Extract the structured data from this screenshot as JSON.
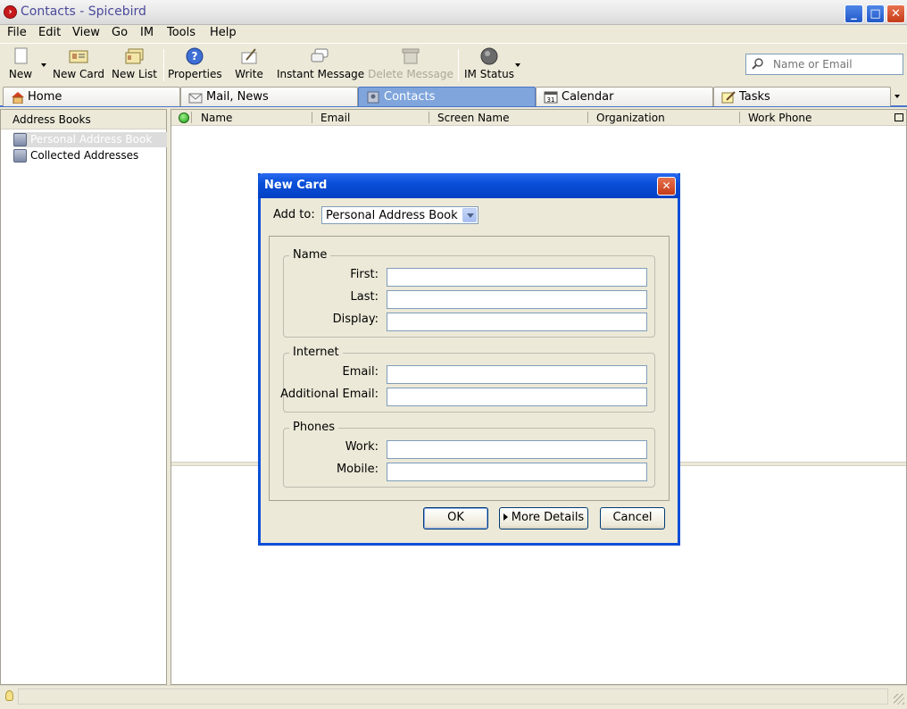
{
  "window": {
    "title": "Contacts - Spicebird"
  },
  "menu": [
    "File",
    "Edit",
    "View",
    "Go",
    "IM",
    "Tools",
    "Help"
  ],
  "toolbar": {
    "new": "New",
    "new_card": "New Card",
    "new_list": "New List",
    "properties": "Properties",
    "write": "Write",
    "instant_message": "Instant Message",
    "delete_message": "Delete Message",
    "im_status": "IM Status"
  },
  "search": {
    "placeholder": "Name or Email"
  },
  "tabs": [
    {
      "label": "Home"
    },
    {
      "label": "Mail, News"
    },
    {
      "label": "Contacts",
      "active": true
    },
    {
      "label": "Calendar"
    },
    {
      "label": "Tasks"
    }
  ],
  "address_books": {
    "header": "Address Books",
    "items": [
      "Personal Address Book",
      "Collected Addresses"
    ]
  },
  "columns": [
    "Name",
    "Email",
    "Screen Name",
    "Organization",
    "Work Phone"
  ],
  "dialog": {
    "title": "New Card",
    "add_to_label": "Add to:",
    "add_to_value": "Personal Address Book",
    "name_group": "Name",
    "first": "First:",
    "last": "Last:",
    "display": "Display:",
    "internet_group": "Internet",
    "email": "Email:",
    "additional_email": "Additional Email:",
    "phones_group": "Phones",
    "work": "Work:",
    "mobile": "Mobile:",
    "ok": "OK",
    "more_details": "More Details",
    "cancel": "Cancel"
  },
  "colors": {
    "accent": "#0a4fd8",
    "active_tab": "#7fa5dc"
  }
}
